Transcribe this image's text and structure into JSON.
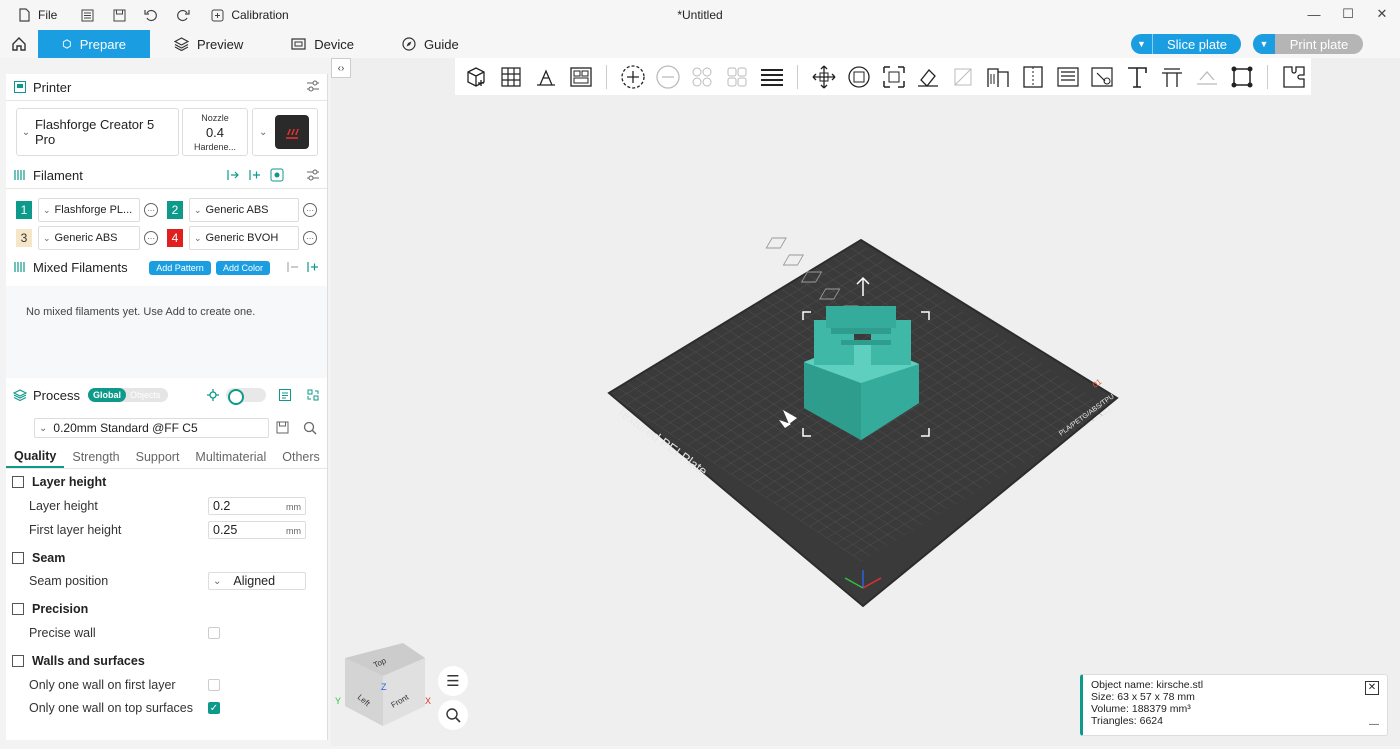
{
  "titlebar": {
    "file_label": "File",
    "calibration_label": "Calibration",
    "document_title": "*Untitled"
  },
  "menubar": {
    "tabs": [
      {
        "label": "Prepare"
      },
      {
        "label": "Preview"
      },
      {
        "label": "Device"
      },
      {
        "label": "Guide"
      }
    ],
    "slice_label": "Slice plate",
    "print_label": "Print plate"
  },
  "printer": {
    "section_title": "Printer",
    "name": "Flashforge Creator 5 Pro",
    "nozzle_label": "Nozzle",
    "nozzle_value": "0.4",
    "nozzle_type": "Hardene..."
  },
  "filament": {
    "section_title": "Filament",
    "items": [
      {
        "num": "1",
        "name": "Flashforge PL...",
        "color": "#0e9a8a"
      },
      {
        "num": "2",
        "name": "Generic ABS",
        "color": "#0e9a8a"
      },
      {
        "num": "3",
        "name": "Generic ABS",
        "color": "#f5e6c8"
      },
      {
        "num": "4",
        "name": "Generic BVOH",
        "color": "#e02020"
      }
    ]
  },
  "mixed": {
    "section_title": "Mixed Filaments",
    "add_pattern": "Add Pattern",
    "add_color": "Add Color",
    "empty_text": "No mixed filaments yet. Use Add to create one."
  },
  "process": {
    "section_title": "Process",
    "toggle_global": "Global",
    "toggle_objects": "Objects",
    "profile": "0.20mm Standard @FF C5",
    "tabs": [
      "Quality",
      "Strength",
      "Support",
      "Multimaterial",
      "Others"
    ],
    "groups": {
      "layer_height": "Layer height",
      "seam": "Seam",
      "precision": "Precision",
      "walls": "Walls and surfaces"
    },
    "options": {
      "layer_height_label": "Layer height",
      "layer_height_value": "0.2",
      "first_layer_label": "First layer height",
      "first_layer_value": "0.25",
      "unit": "mm",
      "seam_position_label": "Seam position",
      "seam_position_value": "Aligned",
      "precise_wall_label": "Precise wall",
      "precise_wall_checked": false,
      "one_wall_first_label": "Only one wall on first layer",
      "one_wall_first_checked": false,
      "one_wall_top_label": "Only one wall on top surfaces",
      "one_wall_top_checked": true
    }
  },
  "viewport": {
    "plate_label": "Textured PEI Plate",
    "plate_sub": "PLA/PETG/ABS/TPU",
    "plate_number": "01",
    "cube_top": "Top",
    "cube_left": "Left",
    "cube_front": "Front"
  },
  "object_info": {
    "name": "Object name: kirsche.stl",
    "size": "Size: 63 x 57 x 78 mm",
    "volume": "Volume: 188379 mm³",
    "triangles": "Triangles: 6624"
  },
  "colors": {
    "accent_blue": "#1a9ee1",
    "accent_teal": "#0e9a8a",
    "model": "#3fb8a8",
    "plate": "#3a3a3a"
  }
}
